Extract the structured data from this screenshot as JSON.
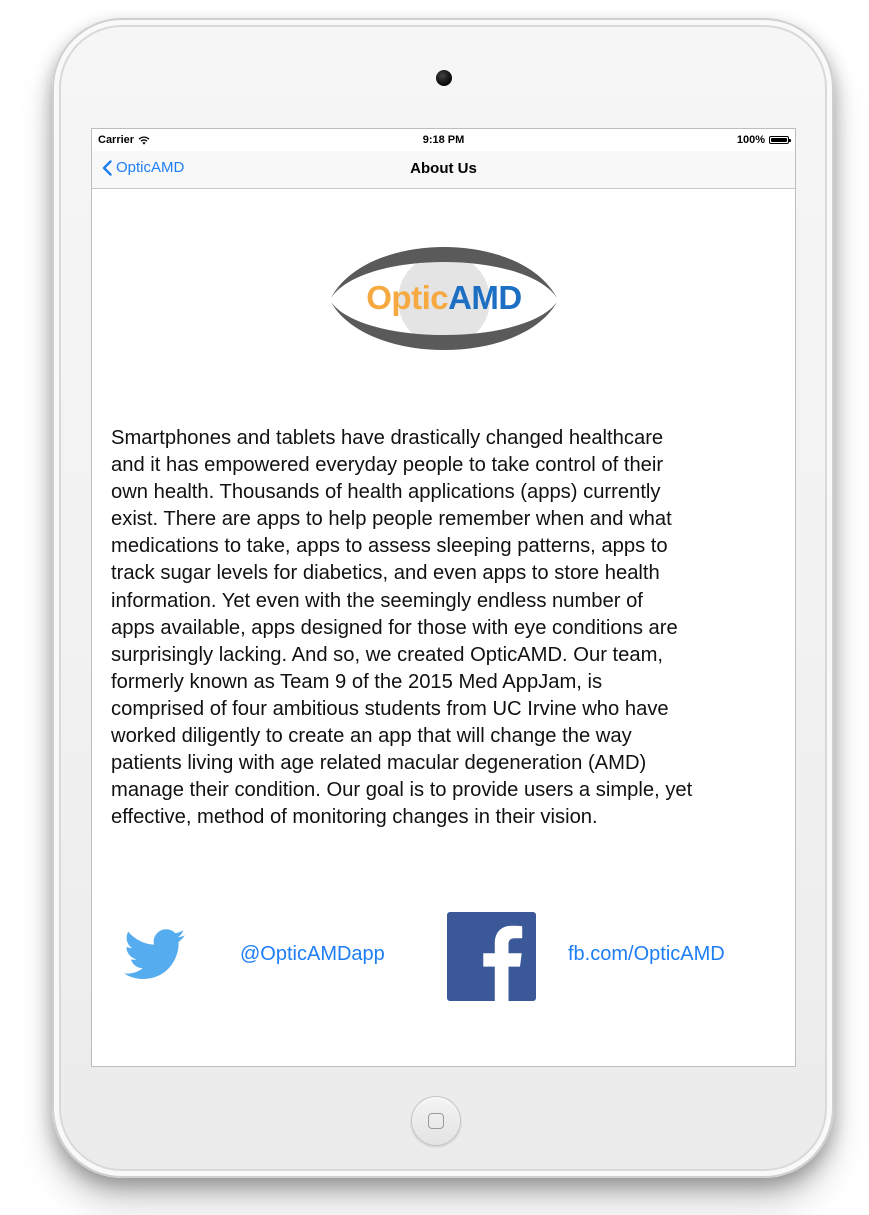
{
  "status_bar": {
    "carrier": "Carrier",
    "time": "9:18 PM",
    "battery": "100%"
  },
  "nav": {
    "back_label": "OpticAMD",
    "title": "About Us"
  },
  "logo": {
    "part1": "Optic",
    "part2": "AMD",
    "color_optic": "#f5a940",
    "color_amd": "#1c6fc2"
  },
  "about": {
    "text": "Smartphones and tablets have drastically changed healthcare\nand it has empowered everyday people to take control of their\nown health.  Thousands of health applications (apps) currently\nexist.  There are apps to help people remember when and what\nmedications to take, apps to assess sleeping patterns, apps to\ntrack sugar levels for diabetics, and even apps to store health\ninformation.  Yet even with the seemingly endless number of\napps available, apps designed for those with eye conditions are\nsurprisingly lacking.  And so, we created OpticAMD.  Our team,\nformerly known as Team 9 of the 2015 Med AppJam, is\ncomprised of four ambitious students from UC Irvine who have\nworked diligently to create an app that will change the way\npatients living with age related macular degeneration (AMD)\nmanage their condition.  Our goal is to provide users a simple, yet\neffective, method of monitoring changes in their vision."
  },
  "social": {
    "twitter_icon": "twitter-bird-icon",
    "twitter_handle": "@OpticAMDapp",
    "facebook_icon": "facebook-f-icon",
    "facebook_link": "fb.com/OpticAMD"
  },
  "colors": {
    "link_blue": "#1d7ef5",
    "twitter_blue": "#55acee",
    "facebook_blue": "#3b5998"
  }
}
